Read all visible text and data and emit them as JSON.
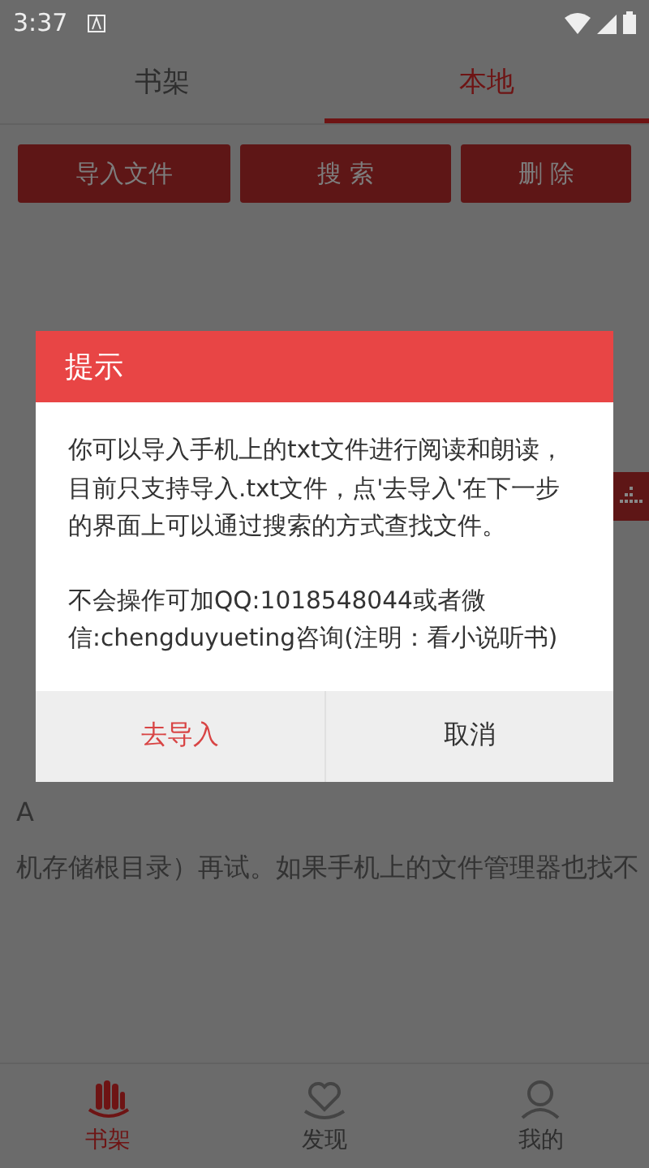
{
  "status_bar": {
    "time": "3:37"
  },
  "tabs": [
    {
      "label": "书架",
      "selected": false
    },
    {
      "label": "本地",
      "selected": true
    }
  ],
  "actions": [
    "导入文件",
    "搜 索",
    "删 除"
  ],
  "background": {
    "paragraphs": [
      {
        "lines": [
          "A",
          "机存储根目录）再试。如果手机上的文件管理器也找不"
        ]
      }
    ]
  },
  "dialog": {
    "title": "提示",
    "paragraphs": [
      "你可以导入手机上的txt文件进行阅读和朗读，目前只支持导入.txt文件，点'去导入'在下一步的界面上可以通过搜索的方式查找文件。",
      "不会操作可加QQ:1018548044或者微信:chengduyueting咨询(注明：看小说听书)"
    ],
    "buttons": [
      {
        "label": "去导入",
        "kind": "primary"
      },
      {
        "label": "取消",
        "kind": "secondary"
      }
    ]
  },
  "bottom_nav": [
    {
      "label": "书架",
      "selected": true,
      "kind": "shelf"
    },
    {
      "label": "发现",
      "selected": false,
      "kind": "discover"
    },
    {
      "label": "我的",
      "selected": false,
      "kind": "profile"
    }
  ]
}
